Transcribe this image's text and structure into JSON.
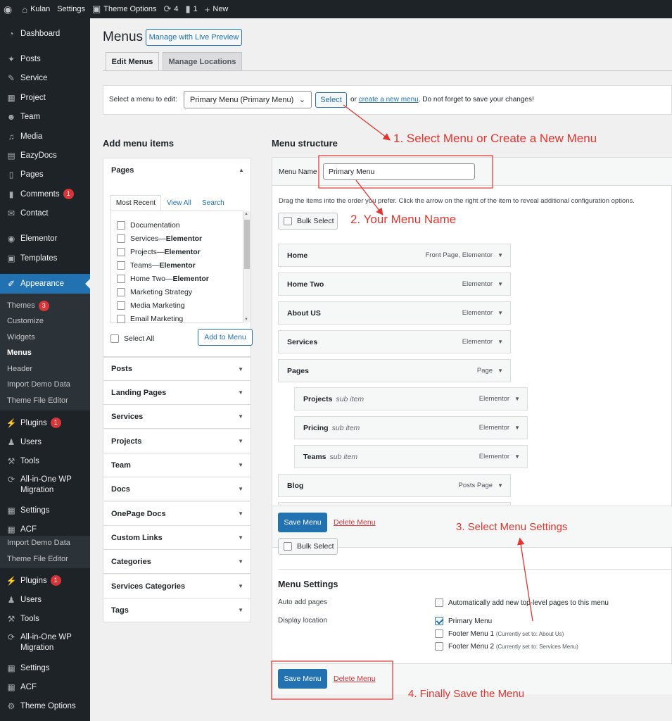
{
  "adminbar": {
    "site": "Kulan",
    "settings": "Settings",
    "theme_options": "Theme Options",
    "updates": "4",
    "comments": "1",
    "new": "New"
  },
  "sidebar": {
    "items": [
      "Dashboard",
      "Posts",
      "Service",
      "Project",
      "Team",
      "Media",
      "EazyDocs",
      "Pages",
      "Comments",
      "Contact",
      "Elementor",
      "Templates",
      "Appearance"
    ],
    "comments_badge": "1",
    "appearance_sub": [
      "Themes",
      "Customize",
      "Widgets",
      "Menus",
      "Header",
      "Import Demo Data",
      "Theme File Editor"
    ],
    "themes_badge": "3",
    "items2": [
      "Plugins",
      "Users",
      "Tools",
      "All-in-One WP",
      "Migration",
      "Settings",
      "ACF"
    ],
    "plugins_badge": "1",
    "sub2": [
      "Import Demo Data",
      "Theme File Editor"
    ],
    "items3": [
      "Plugins",
      "Users",
      "Tools",
      "All-in-One WP",
      "Migration",
      "Settings",
      "ACF",
      "Theme Options"
    ]
  },
  "header": {
    "title": "Menus",
    "live_preview": "Manage with Live Preview",
    "tab_edit": "Edit Menus",
    "tab_locations": "Manage Locations"
  },
  "selectbar": {
    "label": "Select a menu to edit:",
    "selected": "Primary Menu (Primary Menu)",
    "select_btn": "Select",
    "or": "or",
    "create_link": "create a new menu",
    "tail": ". Do not forget to save your changes!"
  },
  "add_items": {
    "heading": "Add menu items",
    "pages_title": "Pages",
    "tabs": [
      "Most Recent",
      "View All",
      "Search"
    ],
    "pages": [
      {
        "name": "Documentation",
        "suffix": ""
      },
      {
        "name": "Services",
        "suffix": "Elementor"
      },
      {
        "name": "Projects",
        "suffix": "Elementor"
      },
      {
        "name": "Teams",
        "suffix": "Elementor"
      },
      {
        "name": "Home Two",
        "suffix": "Elementor"
      },
      {
        "name": "Marketing Strategy",
        "suffix": ""
      },
      {
        "name": "Media Marketing",
        "suffix": ""
      },
      {
        "name": "Email Marketing",
        "suffix": ""
      }
    ],
    "dash": " — ",
    "select_all": "Select All",
    "add_btn": "Add to Menu",
    "sections": [
      "Posts",
      "Landing Pages",
      "Services",
      "Projects",
      "Team",
      "Docs",
      "OnePage Docs",
      "Custom Links",
      "Categories",
      "Services Categories",
      "Tags"
    ]
  },
  "structure": {
    "heading": "Menu structure",
    "name_label": "Menu Name",
    "name_value": "Primary Menu",
    "instructions": "Drag the items into the order you prefer. Click the arrow on the right of the item to reveal additional configuration options.",
    "bulk_select": "Bulk Select",
    "items": [
      {
        "title": "Home",
        "sub": "",
        "type": "Front Page, Elementor"
      },
      {
        "title": "Home Two",
        "sub": "",
        "type": "Elementor"
      },
      {
        "title": "About US",
        "sub": "",
        "type": "Elementor"
      },
      {
        "title": "Services",
        "sub": "",
        "type": "Elementor"
      },
      {
        "title": "Pages",
        "sub": "",
        "type": "Page"
      },
      {
        "title": "Projects",
        "sub": "sub item",
        "type": "Elementor"
      },
      {
        "title": "Pricing",
        "sub": "sub item",
        "type": "Elementor"
      },
      {
        "title": "Teams",
        "sub": "sub item",
        "type": "Elementor"
      },
      {
        "title": "Blog",
        "sub": "",
        "type": "Posts Page"
      }
    ],
    "save": "Save Menu",
    "delete": "Delete Menu"
  },
  "settings": {
    "heading": "Menu Settings",
    "auto_label": "Auto add pages",
    "auto_text": "Automatically add new top-level pages to this menu",
    "loc_label": "Display location",
    "locations": [
      {
        "name": "Primary Menu",
        "note": ""
      },
      {
        "name": "Footer Menu 1",
        "note": "(Currently set to: About Us)"
      },
      {
        "name": "Footer Menu 2",
        "note": "(Currently set to: Services Menu)"
      }
    ]
  },
  "annotations": [
    "1. Select Menu or Create a New Menu",
    "2. Your Menu Name",
    "3. Select Menu Settings",
    "4. Finally Save the Menu"
  ],
  "colors": {
    "annotation": "#e3342f",
    "accent": "#2271b1",
    "sidebar": "#1d2327"
  }
}
